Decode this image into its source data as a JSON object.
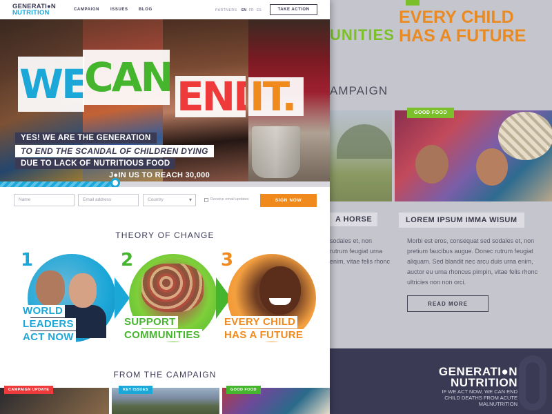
{
  "brand": {
    "logo_line1": "GENERATI●N",
    "logo_line2": "NUTRITION"
  },
  "nav": {
    "links": [
      "CAMPAIGN",
      "ISSUES",
      "BLOG"
    ],
    "partners": "PARTNERS",
    "languages": [
      "EN",
      "FR",
      "ES"
    ],
    "active_language": "EN",
    "cta": "TAKE ACTION"
  },
  "hero": {
    "headline": [
      "WE",
      "CAN",
      "END",
      "IT."
    ],
    "tagline": [
      "YES! WE ARE THE GENERATION",
      "TO END THE SCANDAL OF CHILDREN DYING",
      "DUE TO LACK OF NUTRITIOUS FOOD"
    ],
    "join_text": "J●IN US TO REACH 30,000",
    "progress_fraction": 0.35
  },
  "signup_form": {
    "name_placeholder": "Name",
    "email_placeholder": "Email address",
    "country_placeholder": "Country",
    "checkbox_label": "Receive email updates",
    "submit_label": "SIGN NOW"
  },
  "theory_of_change": {
    "title": "THEORY OF CHANGE",
    "steps": [
      {
        "number": "1",
        "label_lines": [
          "WORLD",
          "LEADERS",
          "ACT NOW"
        ]
      },
      {
        "number": "2",
        "label_lines": [
          "SUPPORT",
          "COMMUNITIES"
        ]
      },
      {
        "number": "3",
        "label_lines": [
          "EVERY CHILD",
          "HAS A FUTURE"
        ]
      }
    ]
  },
  "from_the_campaign": {
    "title": "FROM THE CAMPAIGN",
    "cards": [
      {
        "badge": "CAMPAIGN UPDATE"
      },
      {
        "badge": "KEY ISSUES"
      },
      {
        "badge": "GOOD FOOD"
      }
    ]
  },
  "back_page": {
    "top_green_fragment": "UNITIES",
    "top_orange_lines": [
      "EVERY CHILD",
      "HAS A FUTURE"
    ],
    "section_fragment": "AMPAIGN",
    "card_badge": "GOOD FOOD",
    "left_card_title_fragment": "A HORSE",
    "card_title": "LOREM IPSUM IMMA WISUM",
    "left_card_text": "sodales et, non rutrum feugiat urna enim, vitae felis rhonc",
    "card_text": "Morbi est eros, consequat sed sodales et, non pretium faucibus augue. Donec rutrum feugiat aliquam. Sed blandit nec arcu duis urna enim, auctor eu urna rhoncus pimpin, vitae felis rhonc ultricies non non orci.",
    "read_more": "READ MORE",
    "footer_logo_line1": "GENERATI●N",
    "footer_logo_line2": "NUTRITION",
    "footer_tagline": "IF WE ACT NOW, WE CAN END CHILD DEATHS FROM ACUTE MALNUTRITION"
  },
  "colors": {
    "navy": "#3b3a55",
    "blue": "#1ba7d8",
    "green": "#46b52e",
    "red": "#ee3a3a",
    "orange": "#f08a1c"
  }
}
